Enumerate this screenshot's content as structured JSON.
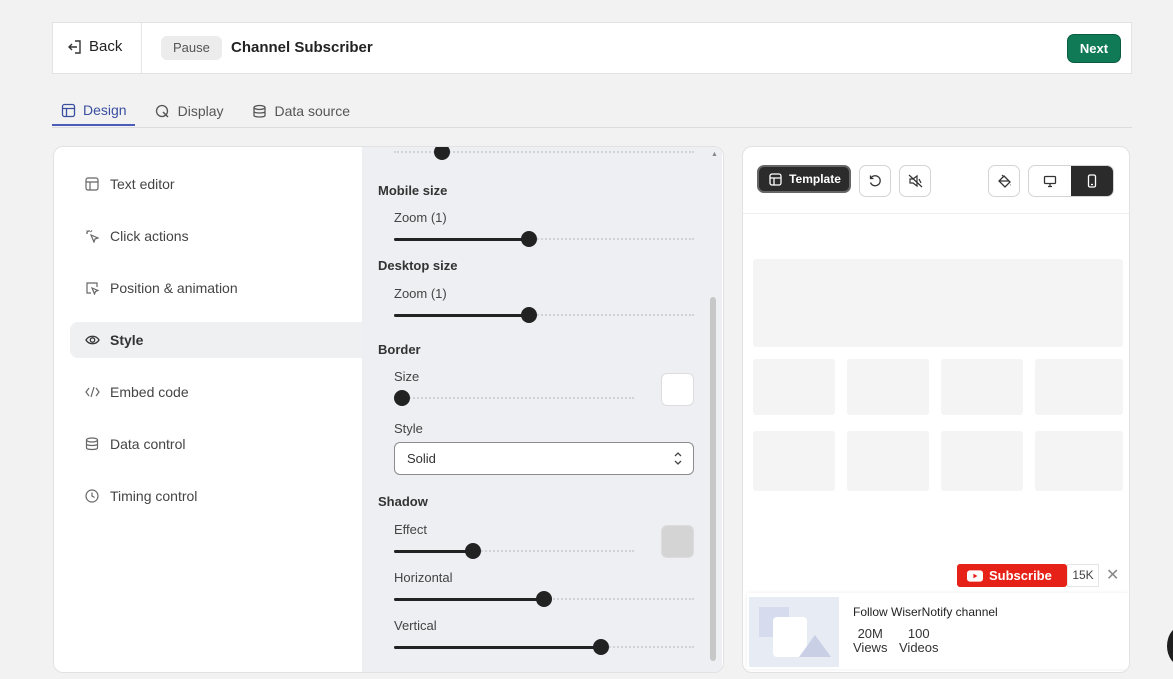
{
  "header": {
    "back_label": "Back",
    "status_label": "Pause",
    "title": "Channel Subscriber",
    "next_label": "Next"
  },
  "tabs": [
    {
      "label": "Design",
      "icon": "design-icon",
      "active": true
    },
    {
      "label": "Display",
      "icon": "display-icon"
    },
    {
      "label": "Data source",
      "icon": "database-icon"
    }
  ],
  "nav": [
    {
      "label": "Text editor",
      "icon": "text-editor-icon"
    },
    {
      "label": "Click actions",
      "icon": "click-icon"
    },
    {
      "label": "Position & animation",
      "icon": "position-icon"
    },
    {
      "label": "Style",
      "icon": "eye-icon",
      "active": true
    },
    {
      "label": "Embed code",
      "icon": "code-icon"
    },
    {
      "label": "Data control",
      "icon": "database-icon"
    },
    {
      "label": "Timing control",
      "icon": "clock-icon"
    }
  ],
  "settings": {
    "mobile_size": {
      "title": "Mobile size",
      "zoom_label": "Zoom (1)",
      "value": 0.45
    },
    "desktop_size": {
      "title": "Desktop size",
      "zoom_label": "Zoom (1)",
      "value": 0.45
    },
    "border": {
      "title": "Border",
      "size_label": "Size",
      "size_value": 0,
      "style_label": "Style",
      "style_value": "Solid",
      "color": "#ffffff"
    },
    "shadow": {
      "title": "Shadow",
      "effect_label": "Effect",
      "effect_value": 0.33,
      "horizontal_label": "Horizontal",
      "horizontal_value": 0.5,
      "vertical_label": "Vertical",
      "vertical_value": 0.69,
      "color": "#d4d4d4"
    }
  },
  "preview": {
    "template_label": "Template",
    "subscribe_label": "Subscribe",
    "subscriber_count": "15K",
    "notification_title": "Follow WiserNotify channel",
    "views_value": "20M",
    "views_label": "Views",
    "videos_value": "100",
    "videos_label": "Videos"
  },
  "colors": {
    "accent": "#0f7a55",
    "tab_active": "#3a4fa0",
    "youtube_red": "#e62117"
  }
}
